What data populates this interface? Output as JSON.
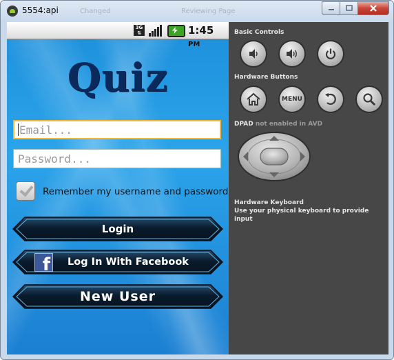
{
  "window": {
    "title": "5554:api",
    "background_tabs": [
      "Changed",
      "Reviewing Page"
    ]
  },
  "status_bar": {
    "network": "3G",
    "time": "1:45",
    "ampm": "PM"
  },
  "app": {
    "logo_text": "Quiz",
    "email_placeholder": "Email...",
    "password_placeholder": "Password...",
    "remember_label": "Remember my username and password",
    "remember_checked": true,
    "login_label": "Login",
    "facebook_label": "Log In With Facebook",
    "new_user_label": "New User",
    "colors": {
      "background_blue": "#1d8fdb",
      "logo_navy": "#0b2a5c",
      "button_dark": "#0a1a2a"
    }
  },
  "controls": {
    "basic_controls_title": "Basic Controls",
    "basic_buttons": [
      "volume-down-icon",
      "volume-up-icon",
      "power-icon"
    ],
    "hardware_buttons_title": "Hardware Buttons",
    "hardware_buttons": [
      "home-icon",
      "MENU",
      "back-icon",
      "search-icon"
    ],
    "menu_label": "MENU",
    "dpad_title": "DPAD",
    "dpad_note": "not enabled in AVD",
    "keyboard_title": "Hardware Keyboard",
    "keyboard_note": "Use your physical keyboard to provide input"
  }
}
